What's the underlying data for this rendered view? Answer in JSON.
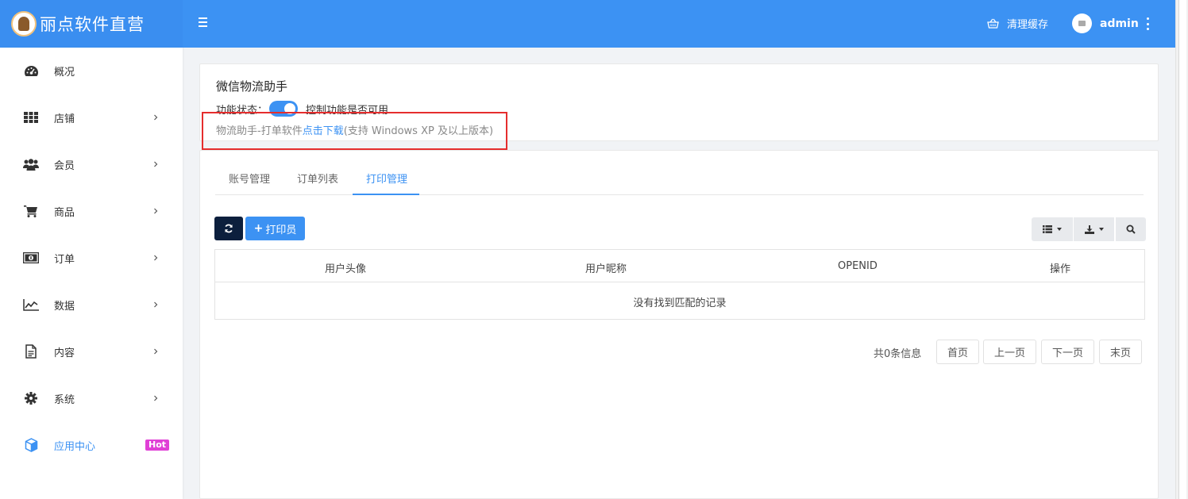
{
  "header": {
    "brand_title": "丽点软件直营",
    "clear_cache": "清理缓存",
    "username": "admin"
  },
  "sidebar": {
    "items": [
      {
        "label": "概况",
        "icon": "dashboard-icon",
        "has_arrow": false
      },
      {
        "label": "店铺",
        "icon": "grid-icon",
        "has_arrow": true
      },
      {
        "label": "会员",
        "icon": "users-icon",
        "has_arrow": true
      },
      {
        "label": "商品",
        "icon": "cart-icon",
        "has_arrow": true
      },
      {
        "label": "订单",
        "icon": "money-icon",
        "has_arrow": true
      },
      {
        "label": "数据",
        "icon": "chart-icon",
        "has_arrow": true
      },
      {
        "label": "内容",
        "icon": "document-icon",
        "has_arrow": true
      },
      {
        "label": "系统",
        "icon": "gear-icon",
        "has_arrow": true
      },
      {
        "label": "应用中心",
        "icon": "cube-icon",
        "badge": "Hot",
        "active": true
      }
    ]
  },
  "plugin": {
    "title": "微信物流助手",
    "status_label": "功能状态：",
    "status_desc": "控制功能是否可用",
    "download_prefix": "物流助手-打单软件",
    "download_link": "点击下载",
    "download_suffix": "(支持 Windows XP 及以上版本)"
  },
  "tabs": [
    "账号管理",
    "订单列表",
    "打印管理"
  ],
  "active_tab": 2,
  "toolbar": {
    "add_label": "打印员"
  },
  "table": {
    "columns": [
      "用户头像",
      "用户昵称",
      "OPENID",
      "操作"
    ],
    "empty_text": "没有找到匹配的记录"
  },
  "pagination": {
    "total": "共0条信息",
    "first": "首页",
    "prev": "上一页",
    "next": "下一页",
    "last": "末页"
  }
}
